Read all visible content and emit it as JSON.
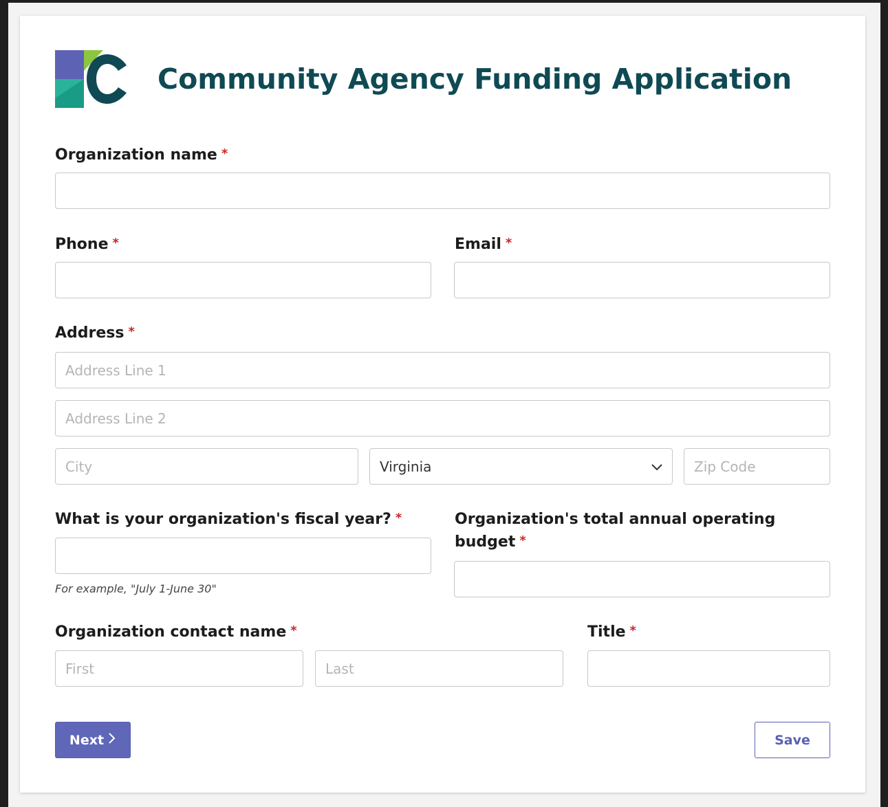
{
  "app": {
    "title": "Community Agency Funding Application",
    "brand_colors": {
      "title": "#0f4a54",
      "logo_purple": "#5d62b5",
      "logo_teal": "#1a9b86",
      "logo_green": "#8cc63f",
      "logo_dark": "#0f4a54",
      "required": "#c62828",
      "button_primary": "#6066b8"
    }
  },
  "form": {
    "required_marker": "*",
    "org_name": {
      "label": "Organization name",
      "value": ""
    },
    "phone": {
      "label": "Phone",
      "value": ""
    },
    "email": {
      "label": "Email",
      "value": ""
    },
    "address": {
      "label": "Address",
      "line1_placeholder": "Address Line 1",
      "line2_placeholder": "Address Line 2",
      "city_placeholder": "City",
      "state_value": "Virginia",
      "zip_placeholder": "Zip Code"
    },
    "fiscal_year": {
      "label": "What is your organization's fiscal year?",
      "value": "",
      "help": "For example, \"July 1-June 30\""
    },
    "budget": {
      "label_line1": "Organization's total annual operating",
      "label_line2": "budget",
      "value": ""
    },
    "contact": {
      "label": "Organization contact name",
      "first_placeholder": "First",
      "last_placeholder": "Last"
    },
    "title": {
      "label": "Title",
      "value": ""
    }
  },
  "actions": {
    "next_label": "Next",
    "save_label": "Save"
  }
}
